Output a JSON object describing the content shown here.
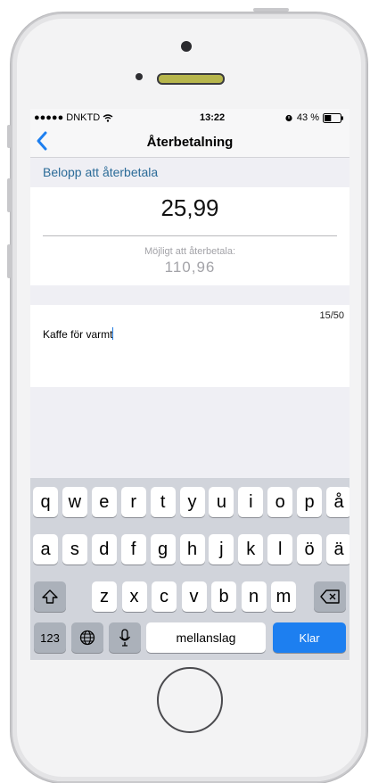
{
  "status": {
    "carrier": "●●●●● DNKTD",
    "time": "13:22",
    "battery_pct": "43 %",
    "battery_level": 0.43
  },
  "nav": {
    "title": "Återbetalning"
  },
  "form": {
    "section_label": "Belopp att återbetala",
    "amount": "25,99",
    "possible_label": "Möjligt att återbetala:",
    "possible_value": "110,96",
    "note_text": "Kaffe för varmt",
    "counter": "15/50"
  },
  "keyboard": {
    "row1": [
      "q",
      "w",
      "e",
      "r",
      "t",
      "y",
      "u",
      "i",
      "o",
      "p",
      "å"
    ],
    "row2": [
      "a",
      "s",
      "d",
      "f",
      "g",
      "h",
      "j",
      "k",
      "l",
      "ö",
      "ä"
    ],
    "row3": [
      "z",
      "x",
      "c",
      "v",
      "b",
      "n",
      "m"
    ],
    "numbers_label": "123",
    "space_label": "mellanslag",
    "return_label": "Klar"
  },
  "icons": [
    "chevron-left-icon",
    "wifi-icon",
    "alarm-icon",
    "battery-icon",
    "shift-icon",
    "delete-icon",
    "globe-icon",
    "microphone-icon"
  ],
  "colors": {
    "accent": "#1d7ff0",
    "section_label": "#2b6b98"
  }
}
